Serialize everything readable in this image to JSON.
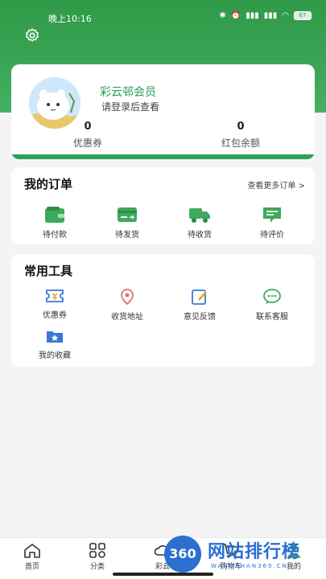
{
  "status_bar": {
    "time": "晚上10:16",
    "battery": "67"
  },
  "member": {
    "name": "彩云邨会员",
    "login_hint": "请登录后查看",
    "stats": [
      {
        "value": "0",
        "label": "优惠券"
      },
      {
        "value": "0",
        "label": "红包余额"
      }
    ]
  },
  "orders": {
    "title": "我的订单",
    "more": "查看更多订单 >",
    "items": [
      {
        "label": "待付款",
        "icon": "wallet-icon"
      },
      {
        "label": "待发货",
        "icon": "card-ship-icon"
      },
      {
        "label": "待收货",
        "icon": "truck-icon"
      },
      {
        "label": "待评价",
        "icon": "comment-icon"
      }
    ]
  },
  "tools": {
    "title": "常用工具",
    "items": [
      {
        "label": "优惠券",
        "icon": "coupon-icon"
      },
      {
        "label": "收货地址",
        "icon": "location-icon"
      },
      {
        "label": "意见反馈",
        "icon": "feedback-icon"
      },
      {
        "label": "联系客服",
        "icon": "service-icon"
      },
      {
        "label": "我的收藏",
        "icon": "favorites-icon"
      }
    ]
  },
  "bottom_nav": [
    {
      "label": "首页",
      "icon": "home-icon"
    },
    {
      "label": "分类",
      "icon": "category-icon"
    },
    {
      "label": "彩云",
      "icon": "caiyun-icon"
    },
    {
      "label": "购物车",
      "icon": "cart-icon"
    },
    {
      "label": "我的",
      "icon": "user-icon"
    }
  ],
  "watermark": {
    "badge": "360",
    "text": "网站排行榜",
    "sub": "WANGZHAN360.CN"
  },
  "colors": {
    "brand_green": "#2aa05a",
    "accent_green": "#3aa656",
    "watermark_blue": "#2b6fd1"
  }
}
